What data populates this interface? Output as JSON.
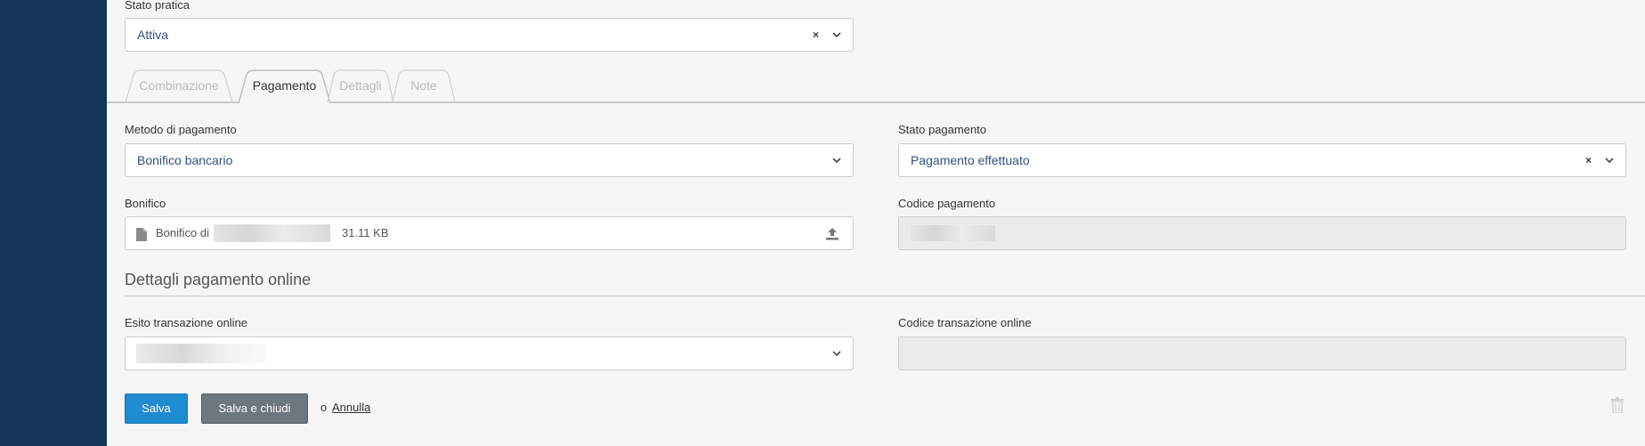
{
  "form": {
    "stato_pratica": {
      "label": "Stato pratica",
      "value": "Attiva"
    },
    "tabs": [
      {
        "label": "Combinazione",
        "active": false
      },
      {
        "label": "Pagamento",
        "active": true
      },
      {
        "label": "Dettagli",
        "active": false
      },
      {
        "label": "Note",
        "active": false
      }
    ],
    "metodo": {
      "label": "Metodo di pagamento",
      "value": "Bonifico bancario"
    },
    "stato_pagamento": {
      "label": "Stato pagamento",
      "value": "Pagamento effettuato"
    },
    "bonifico": {
      "label": "Bonifico",
      "file_prefix": "Bonifico di",
      "file_size": "31.11 KB"
    },
    "codice_pagamento": {
      "label": "Codice pagamento"
    },
    "online": {
      "title": "Dettagli pagamento online",
      "esito_label": "Esito transazione online",
      "codice_label": "Codice transazione online"
    }
  },
  "actions": {
    "save": "Salva",
    "save_close": "Salva e chiudi",
    "or": "o",
    "cancel": "Annulla"
  },
  "colors": {
    "sidebar": "#133656",
    "primary": "#1f8bd1",
    "secondary": "#6e767e",
    "value_text": "#33507a"
  }
}
